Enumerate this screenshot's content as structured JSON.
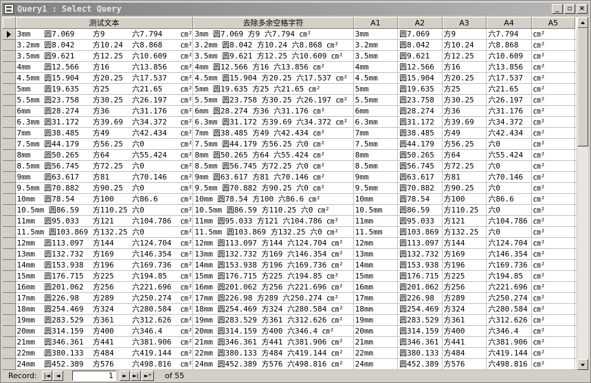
{
  "window": {
    "title": "Query1 : Select Query",
    "icon": "datasheet-icon"
  },
  "titlebar_buttons": {
    "minimize": "_",
    "restore": "▫",
    "close": "×"
  },
  "columns": [
    "",
    "测试文本",
    "去除多余空格字符",
    "A1",
    "A2",
    "A3",
    "A4",
    "A5"
  ],
  "rows": [
    [
      "3mm   圆7.069    方9      六7.794    ㎝²",
      "3mm 圆7.069 方9 六7.794 ㎝²",
      "3mm",
      "圆7.069",
      "方9",
      "六7.794",
      "㎝²"
    ],
    [
      "3.2mm 圆8.042    方10.24  六8.868    ㎝²",
      "3.2mm 圆8.042 方10.24 六8.868 ㎝²",
      "3.2mm",
      "圆8.042",
      "方10.24",
      "六8.868",
      "㎝²"
    ],
    [
      "3.5mm 圆9.621    方12.25  六10.609   ㎝²",
      "3.5mm 圆9.621 方12.25 六10.609 ㎝²",
      "3.5mm",
      "圆9.621",
      "方12.25",
      "六10.609",
      "㎝²"
    ],
    [
      "4mm   圆12.566   方16     六13.856   ㎝²",
      "4mm 圆12.566 方16 六13.856 ㎝²",
      "4mm",
      "圆12.566",
      "方16",
      "六13.856",
      "㎝²"
    ],
    [
      "4.5mm 圆15.904   方20.25  六17.537   ㎝²",
      "4.5mm 圆15.904 方20.25 六17.537 ㎝²",
      "4.5mm",
      "圆15.904",
      "方20.25",
      "六17.537",
      "㎝²"
    ],
    [
      "5mm   圆19.635   方25     六21.65    ㎝²",
      "5mm 圆19.635 方25 六21.65 ㎝²",
      "5mm",
      "圆19.635",
      "方25",
      "六21.65",
      "㎝²"
    ],
    [
      "5.5mm 圆23.758   方30.25  六26.197   ㎝²",
      "5.5mm 圆23.758 方30.25 六26.197 ㎝²",
      "5.5mm",
      "圆23.758",
      "方30.25",
      "六26.197",
      "㎝²"
    ],
    [
      "6mm   圆28.274   方36     六31.176   ㎝²",
      "6mm 圆28.274 方36 六31.176 ㎝²",
      "6mm",
      "圆28.274",
      "方36",
      "六31.176",
      "㎝²"
    ],
    [
      "6.3mm 圆31.172   方39.69  六34.372   ㎝²",
      "6.3mm 圆31.172 方39.69 六34.372 ㎝²",
      "6.3mm",
      "圆31.172",
      "方39.69",
      "六34.372",
      "㎝²"
    ],
    [
      "7mm   圆38.485   方49     六42.434   ㎝²",
      "7mm 圆38.485 方49 六42.434 ㎝²",
      "7mm",
      "圆38.485",
      "方49",
      "六42.434",
      "㎝²"
    ],
    [
      "7.5mm 圆44.179   方56.25  六0        ㎝²",
      "7.5mm 圆44.179 方56.25 六0 ㎝²",
      "7.5mm",
      "圆44.179",
      "方56.25",
      "六0",
      "㎝²"
    ],
    [
      "8mm   圆50.265   方64     六55.424   ㎝²",
      "8mm 圆50.265 方64 六55.424 ㎝²",
      "8mm",
      "圆50.265",
      "方64",
      "六55.424",
      "㎝²"
    ],
    [
      "8.5mm 圆56.745   方72.25  六0        ㎝²",
      "8.5mm 圆56.745 方72.25 六0 ㎝²",
      "8.5mm",
      "圆56.745",
      "方72.25",
      "六0",
      "㎝²"
    ],
    [
      "9mm   圆63.617   方81     六70.146   ㎝²",
      "9mm 圆63.617 方81 六70.146 ㎝²",
      "9mm",
      "圆63.617",
      "方81",
      "六70.146",
      "㎝²"
    ],
    [
      "9.5mm 圆70.882   方90.25  六0        ㎝²",
      "9.5mm 圆70.882 方90.25 六0 ㎝²",
      "9.5mm",
      "圆70.882",
      "方90.25",
      "六0",
      "㎝²"
    ],
    [
      "10mm  圆78.54    方100    六86.6     ㎝²",
      "10mm 圆78.54 方100 六86.6 ㎝²",
      "10mm",
      "圆78.54",
      "方100",
      "六86.6",
      "㎝²"
    ],
    [
      "10.5mm 圆86.59   方110.25 六0        ㎝²",
      "10.5mm 圆86.59 方110.25 六0 ㎝²",
      "10.5mm",
      "圆86.59",
      "方110.25",
      "六0",
      "㎝²"
    ],
    [
      "11mm  圆95.033   方121    六104.786  ㎝²",
      "11mm 圆95.033 方121 六104.786 ㎝²",
      "11mm",
      "圆95.033",
      "方121",
      "六104.786",
      "㎝²"
    ],
    [
      "11.5mm 圆103.869 方132.25 六0        ㎝²",
      "11.5mm 圆103.869 方132.25 六0 ㎝²",
      "11.5mm",
      "圆103.869",
      "方132.25",
      "六0",
      "㎝²"
    ],
    [
      "12mm  圆113.097  方144    六124.704  ㎝²",
      "12mm 圆113.097 方144 六124.704 ㎝²",
      "12mm",
      "圆113.097",
      "方144",
      "六124.704",
      "㎝²"
    ],
    [
      "13mm  圆132.732  方169    六146.354  ㎝²",
      "13mm 圆132.732 方169 六146.354 ㎝²",
      "13mm",
      "圆132.732",
      "方169",
      "六146.354",
      "㎝²"
    ],
    [
      "14mm  圆153.938  方196    六169.736  ㎝²",
      "14mm 圆153.938 方196 六169.736 ㎝²",
      "14mm",
      "圆153.938",
      "方196",
      "六169.736",
      "㎝²"
    ],
    [
      "15mm  圆176.715  方225    六194.85   ㎝²",
      "15mm 圆176.715 方225 六194.85 ㎝²",
      "15mm",
      "圆176.715",
      "方225",
      "六194.85",
      "㎝²"
    ],
    [
      "16mm  圆201.062  方256    六221.696  ㎝²",
      "16mm 圆201.062 方256 六221.696 ㎝²",
      "16mm",
      "圆201.062",
      "方256",
      "六221.696",
      "㎝²"
    ],
    [
      "17mm  圆226.98   方289    六250.274  ㎝²",
      "17mm 圆226.98 方289 六250.274 ㎝²",
      "17mm",
      "圆226.98",
      "方289",
      "六250.274",
      "㎝²"
    ],
    [
      "18mm  圆254.469  方324    六280.584  ㎝²",
      "18mm 圆254.469 方324 六280.584 ㎝²",
      "18mm",
      "圆254.469",
      "方324",
      "六280.584",
      "㎝²"
    ],
    [
      "19mm  圆283.529  方361    六312.626  ㎝²",
      "19mm 圆283.529 方361 六312.626 ㎝²",
      "19mm",
      "圆283.529",
      "方361",
      "六312.626",
      "㎝²"
    ],
    [
      "20mm  圆314.159  方400    六346.4    ㎝²",
      "20mm 圆314.159 方400 六346.4 ㎝²",
      "20mm",
      "圆314.159",
      "方400",
      "六346.4",
      "㎝²"
    ],
    [
      "21mm  圆346.361  方441    六381.906  ㎝²",
      "21mm 圆346.361 方441 六381.906 ㎝²",
      "21mm",
      "圆346.361",
      "方441",
      "六381.906",
      "㎝²"
    ],
    [
      "22mm  圆380.133  方484    六419.144  ㎝²",
      "22mm 圆380.133 方484 六419.144 ㎝²",
      "22mm",
      "圆380.133",
      "方484",
      "六419.144",
      "㎝²"
    ],
    [
      "24mm  圆452.389  方576    六498.816  ㎝²",
      "24mm 圆452.389 方576 六498.816 ㎝²",
      "24mm",
      "圆452.389",
      "方576",
      "六498.816",
      "㎝²"
    ]
  ],
  "navigation": {
    "label": "Record:",
    "first": "|◄",
    "prev": "◄",
    "current": "1",
    "next": "►",
    "last": "►|",
    "new": "►*",
    "of_label": "of",
    "total": "55"
  }
}
